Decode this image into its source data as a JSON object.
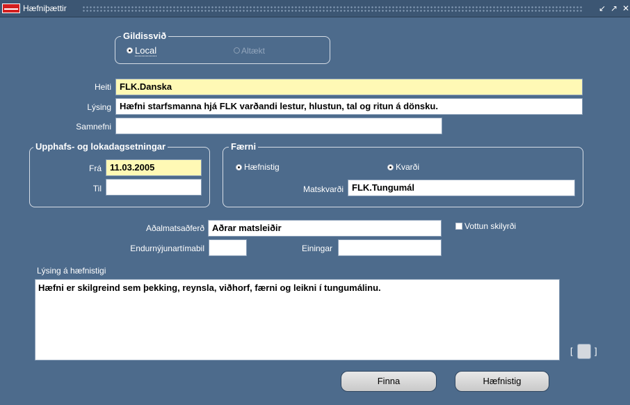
{
  "window": {
    "title": "Hæfniþættir",
    "buttons": [
      "minimize-icon",
      "maximize-icon",
      "close-icon"
    ]
  },
  "scope": {
    "title": "Gildissvið",
    "options": [
      {
        "label": "Local",
        "selected": true,
        "enabled": true
      },
      {
        "label": "Altækt",
        "selected": false,
        "enabled": false
      }
    ]
  },
  "fields": {
    "heiti": {
      "label": "Heiti",
      "value": "FLK.Danska"
    },
    "lysing": {
      "label": "Lýsing",
      "value": "Hæfni starfsmanna hjá FLK varðandi lestur, hlustun, tal og ritun á dönsku."
    },
    "samnefni": {
      "label": "Samnefni",
      "value": ""
    }
  },
  "dates": {
    "title": "Upphafs- og lokadagsetningar",
    "from_label": "Frá",
    "from_value": "11.03.2005",
    "to_label": "Til",
    "to_value": ""
  },
  "skill": {
    "title": "Færni",
    "options": [
      {
        "label": "Hæfnistig",
        "selected": true
      },
      {
        "label": "Kvarði",
        "selected": false
      }
    ],
    "scale_label": "Matskvarði",
    "scale_value": "FLK.Tungumál"
  },
  "assessment": {
    "method_label": "Aðalmatsaðferð",
    "method_value": "Aðrar matsleiðir",
    "cert_label": "Vottun skilyrði",
    "cert_checked": false,
    "renewal_label": "Endurnýjunartímabil",
    "renewal_value": "",
    "units_label": "Einingar",
    "units_value": ""
  },
  "level_description": {
    "label": "Lýsing á hæfnistigi",
    "value": "Hæfni er skilgreind sem þekking, reynsla, viðhorf, færni og leikni í tungumálinu."
  },
  "buttons": {
    "find": "Finna",
    "level": "Hæfnistig"
  },
  "colors": {
    "background": "#4d6b8c",
    "required_field": "#fff9b5"
  }
}
